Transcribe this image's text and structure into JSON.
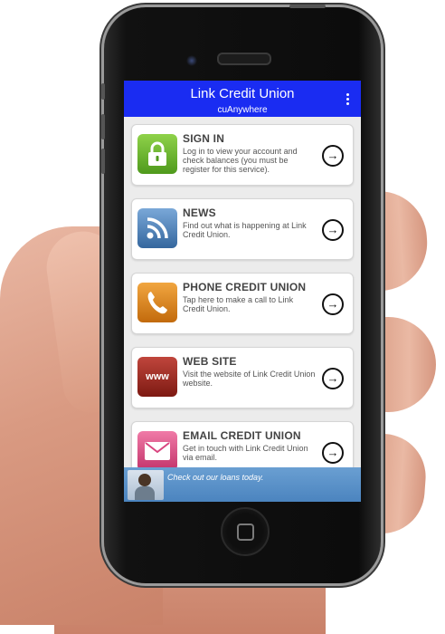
{
  "header": {
    "title": "Link Credit Union",
    "subtitle": "cuAnywhere",
    "menu_icon": "kebab-menu-icon"
  },
  "menu_items": [
    {
      "id": "sign-in",
      "label": "SIGN IN",
      "description": "Log in to view your account and check balances (you must be register for this service).",
      "icon": "lock-icon",
      "color": "#5fae28"
    },
    {
      "id": "news",
      "label": "NEWS",
      "description": "Find out what is happening at Link Credit Union.",
      "icon": "rss-icon",
      "color": "#3f74ae"
    },
    {
      "id": "phone",
      "label": "PHONE CREDIT UNION",
      "description": "Tap here to make a call to Link Credit Union.",
      "icon": "phone-icon",
      "color": "#d98214"
    },
    {
      "id": "website",
      "label": "WEB SITE",
      "description": "Visit the website of Link Credit Union website.",
      "icon": "www-icon",
      "icon_text": "www",
      "color": "#9b2a20"
    },
    {
      "id": "email",
      "label": "EMAIL CREDIT UNION",
      "description": "Get in touch with Link Credit Union via email.",
      "icon": "envelope-icon",
      "color": "#d9457f"
    }
  ],
  "banner": {
    "text": "Check out our loans today."
  },
  "colors": {
    "appbar": "#1a2cf2",
    "banner": "#5a92c8"
  }
}
